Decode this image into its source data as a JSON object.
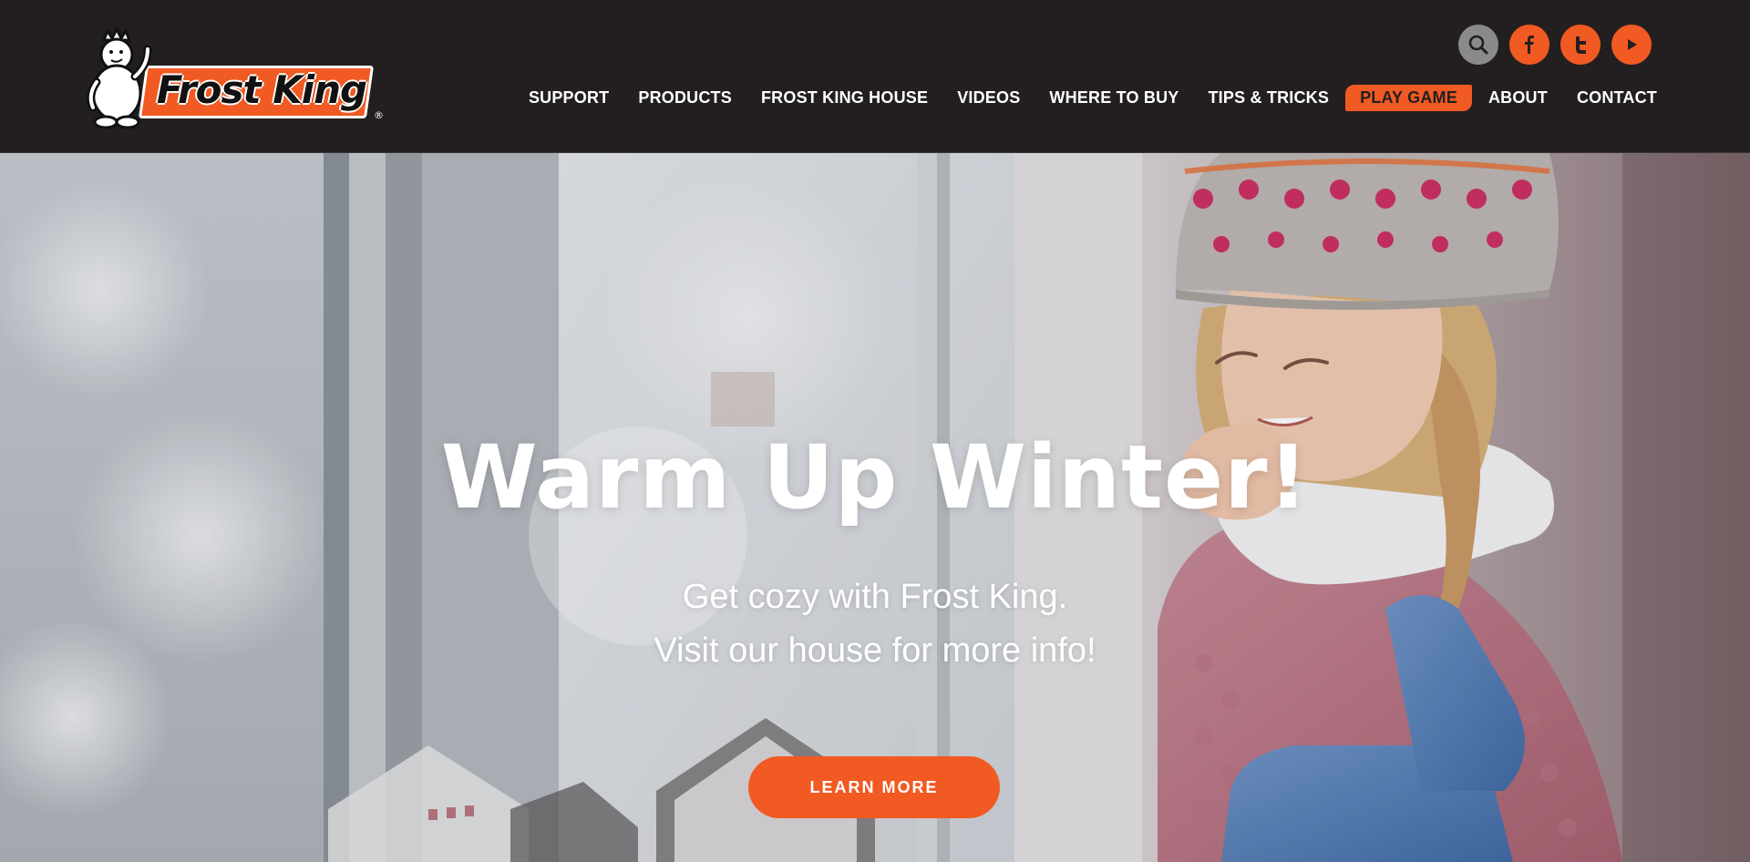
{
  "brand": {
    "name": "Frost King",
    "reg": "®"
  },
  "colors": {
    "accent": "#f15a22",
    "header_bg": "#231f20",
    "search_bg": "#8a8a8a"
  },
  "social": [
    {
      "name": "search-icon"
    },
    {
      "name": "facebook-icon",
      "glyph": "f"
    },
    {
      "name": "twitter-icon",
      "glyph": "t"
    },
    {
      "name": "youtube-icon",
      "glyph": "▶"
    }
  ],
  "nav": {
    "items": [
      "SUPPORT",
      "PRODUCTS",
      "FROST KING HOUSE",
      "VIDEOS",
      "WHERE TO BUY",
      "TIPS & TRICKS",
      "PLAY GAME",
      "ABOUT",
      "CONTACT"
    ]
  },
  "hero": {
    "title": "Warm Up Winter!",
    "subtitle_line1": "Get cozy with Frost King.",
    "subtitle_line2": "Visit our house for more info!",
    "cta_label": "LEARN MORE"
  }
}
